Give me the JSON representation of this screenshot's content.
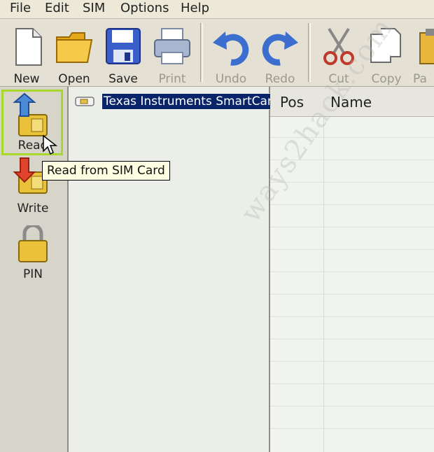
{
  "menu": {
    "items": [
      "File",
      "Edit",
      "SIM",
      "Options",
      "Help"
    ]
  },
  "toolbar": {
    "new_label": "New",
    "open_label": "Open",
    "save_label": "Save",
    "print_label": "Print",
    "undo_label": "Undo",
    "redo_label": "Redo",
    "cut_label": "Cut",
    "copy_label": "Copy",
    "paste_label": "Pa"
  },
  "sidebar": {
    "read_label": "Read",
    "write_label": "Write",
    "pin_label": "PIN"
  },
  "tree": {
    "item_label": "Texas Instruments SmartCard"
  },
  "tooltip": {
    "text": "Read from SIM Card"
  },
  "grid": {
    "columns": [
      "Pos",
      "Name"
    ]
  },
  "watermark": "ways2hack.com",
  "colors": {
    "selection": "#0a246a",
    "highlight": "#a8d82e",
    "tooltip_bg": "#ffffe1"
  }
}
